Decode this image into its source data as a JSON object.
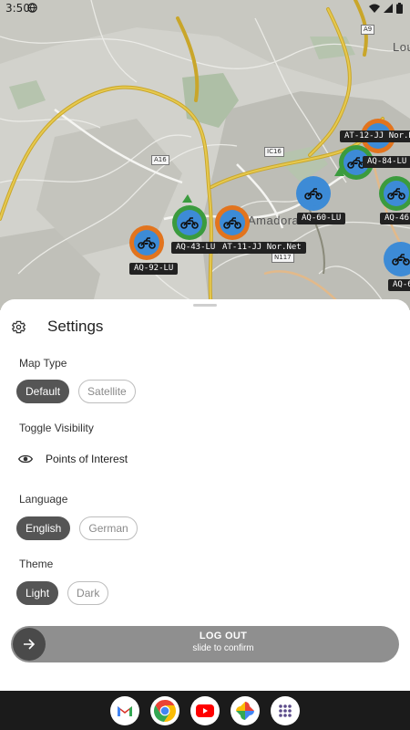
{
  "status_bar": {
    "time": "3:50"
  },
  "map": {
    "place_labels": {
      "amadora": "Amadora",
      "loures": "Lou"
    },
    "road_shields": {
      "a9": "A9",
      "a16": "A16",
      "ic16": "IC16",
      "n117": "N117"
    },
    "markers": [
      {
        "plate": "AT-12-JJ Nor.Net",
        "color": "orange"
      },
      {
        "plate": "AQ-84-LU",
        "color": "green"
      },
      {
        "plate": "AQ-60-LU",
        "color": "blue"
      },
      {
        "plate": "AQ-46",
        "color": "green"
      },
      {
        "plate": "AQ-43-LU",
        "color": "green"
      },
      {
        "plate": "AT-11-JJ Nor.Net",
        "color": "orange"
      },
      {
        "plate": "AQ-92-LU",
        "color": "orange"
      },
      {
        "plate": "AQ-6",
        "color": "blue"
      }
    ]
  },
  "settings": {
    "title": "Settings",
    "map_type": {
      "label": "Map Type",
      "options": [
        "Default",
        "Satellite"
      ],
      "selected": "Default"
    },
    "toggle_visibility": {
      "label": "Toggle Visibility",
      "poi_label": "Points of Interest"
    },
    "language": {
      "label": "Language",
      "options": [
        "English",
        "German"
      ],
      "selected": "English"
    },
    "theme": {
      "label": "Theme",
      "options": [
        "Light",
        "Dark"
      ],
      "selected": "Light"
    },
    "logout": {
      "label": "LOG OUT",
      "hint": "slide to confirm"
    }
  },
  "dock": {
    "apps": [
      "gmail-icon",
      "chrome-icon",
      "youtube-icon",
      "photos-icon",
      "app-drawer-icon"
    ]
  },
  "colors": {
    "marker_orange": "#e2741e",
    "marker_green": "#3b9b3e",
    "marker_blue": "#3d8bd6",
    "chip_selected": "#555555",
    "slider_track": "#8f8f8f"
  }
}
